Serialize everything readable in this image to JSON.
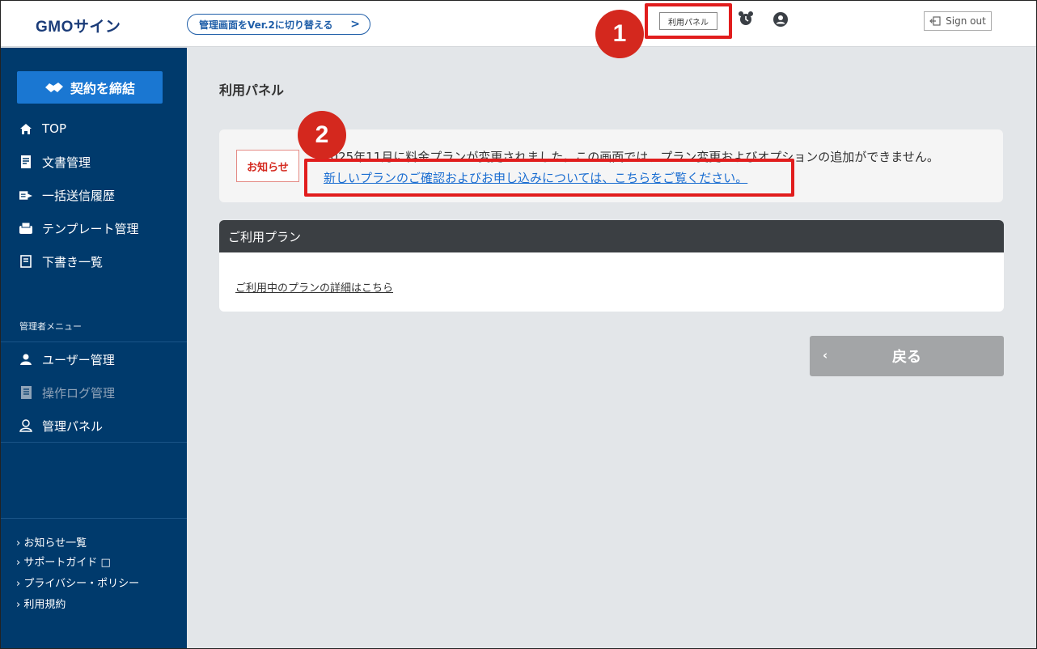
{
  "header": {
    "logo": "GMOサイン",
    "version_switch": "管理画面をVer.2に切り替える",
    "usage_panel_button": "利用パネル",
    "signout": "Sign out"
  },
  "annotations": [
    "1",
    "2"
  ],
  "sidebar": {
    "contract_button": "契約を締結",
    "items": [
      {
        "label": "TOP",
        "icon": "home-icon"
      },
      {
        "label": "文書管理",
        "icon": "document-icon"
      },
      {
        "label": "一括送信履歴",
        "icon": "batch-send-icon"
      },
      {
        "label": "テンプレート管理",
        "icon": "template-icon"
      },
      {
        "label": "下書き一覧",
        "icon": "draft-icon"
      }
    ],
    "admin_section_label": "管理者メニュー",
    "admin_items": [
      {
        "label": "ユーザー管理",
        "icon": "user-icon"
      },
      {
        "label": "操作ログ管理",
        "icon": "log-icon"
      },
      {
        "label": "管理パネル",
        "icon": "admin-panel-icon"
      }
    ],
    "footer_links": [
      "お知らせ一覧",
      "サポートガイド",
      "プライバシー・ポリシー",
      "利用規約"
    ]
  },
  "main": {
    "title": "利用パネル",
    "notice": {
      "badge": "お知らせ",
      "text": "2025年11月に料金プランが変更されました。この画面では、プラン変更およびオプションの追加ができません。",
      "link": "新しいプランのご確認およびお申し込みについては、こちらをご覧ください。"
    },
    "plan": {
      "heading": "ご利用プラン",
      "link": "ご利用中のプランの詳細はこちら"
    },
    "back_button": "戻る"
  },
  "colors": {
    "sidebar_bg": "#003a6c",
    "accent": "#1a77d2",
    "highlight": "#e11d1d",
    "badge_red": "#d4281e"
  }
}
